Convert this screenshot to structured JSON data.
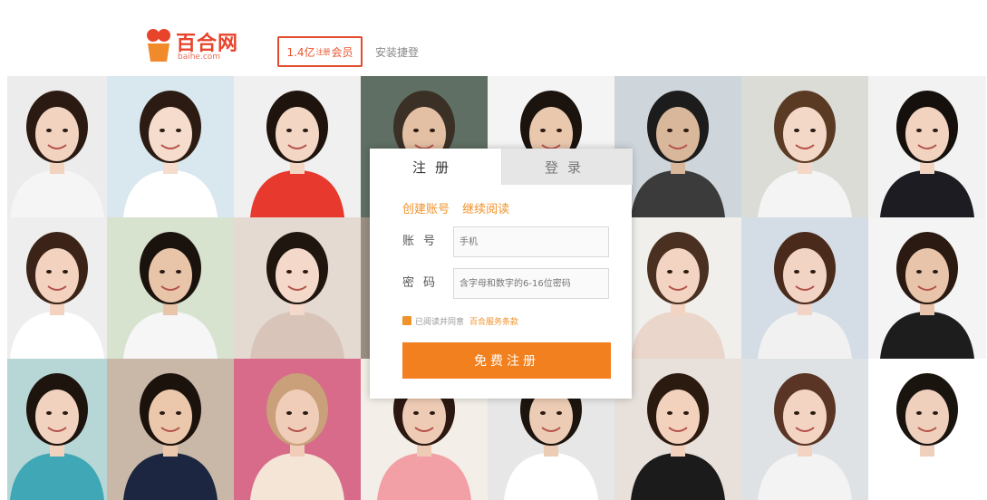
{
  "header": {
    "logo_name": "百合网",
    "logo_domain": "baihe.com",
    "members_count": "1.4亿",
    "members_unit": "注册",
    "members_label": "会员",
    "link_text": "安装捷登"
  },
  "form": {
    "tabs": [
      "注册",
      "登录"
    ],
    "slogan": [
      "创建账号",
      "继续阅读"
    ],
    "account_label": "账号",
    "account_placeholder": "手机",
    "password_label": "密码",
    "password_placeholder": "含字母和数字的6-16位密码",
    "agree_text": "已阅读并同意",
    "agree_link": "百合服务条款",
    "submit_label": "免费注册"
  },
  "colors": {
    "brand": "#e8442b",
    "accent": "#f2801e"
  },
  "profiles": [
    {
      "skin": "#f2d3c0",
      "hair": "#2b1a12",
      "bg": "#ececec",
      "top": "#f5f5f5"
    },
    {
      "skin": "#f5dccc",
      "hair": "#2c1b12",
      "bg": "#d9e7ef",
      "top": "#ffffff"
    },
    {
      "skin": "#f3d6c4",
      "hair": "#1e130d",
      "bg": "#f0f0f0",
      "top": "#e8392f"
    },
    {
      "skin": "#e3c0a4",
      "hair": "#3b3026",
      "bg": "#5f6f63",
      "top": "#8d8d8d"
    },
    {
      "skin": "#eac8ae",
      "hair": "#1b130e",
      "bg": "#f4f4f4",
      "top": "#ffffff"
    },
    {
      "skin": "#d9b79a",
      "hair": "#1c1c1c",
      "bg": "#cfd6db",
      "top": "#3b3b3b"
    },
    {
      "skin": "#f4d8c7",
      "hair": "#5a3a23",
      "bg": "#dcdcd6",
      "top": "#f4f4f4"
    },
    {
      "skin": "#f1d3bf",
      "hair": "#15100c",
      "bg": "#f2f2f2",
      "top": "#1c1c22"
    },
    {
      "skin": "#f3d2bf",
      "hair": "#3b2417",
      "bg": "#eeeeee",
      "top": "#ffffff"
    },
    {
      "skin": "#e8c5a9",
      "hair": "#1a120c",
      "bg": "#d7e2cf",
      "top": "#f6f6f6"
    },
    {
      "skin": "#f4d9ca",
      "hair": "#1f1610",
      "bg": "#e5dad2",
      "top": "#d8c4b8"
    },
    {
      "skin": "#e0b89a",
      "hair": "#2a1b12",
      "bg": "#9b8f84",
      "top": "#d17c52"
    },
    {
      "skin": "#ecd0bc",
      "hair": "#2a2220",
      "bg": "#f1f1f1",
      "top": "#dddddd"
    },
    {
      "skin": "#f3d4c2",
      "hair": "#4a3020",
      "bg": "#f0efec",
      "top": "#ead6cb"
    },
    {
      "skin": "#f1d4c4",
      "hair": "#4a2a1a",
      "bg": "#d4dde6",
      "top": "#f1f1f1"
    },
    {
      "skin": "#e8c5aa",
      "hair": "#2b1a12",
      "bg": "#f4f4f4",
      "top": "#1d1d1d"
    },
    {
      "skin": "#f1d2be",
      "hair": "#1d140e",
      "bg": "#b7d7d6",
      "top": "#3fa7b5"
    },
    {
      "skin": "#ebc8ac",
      "hair": "#1b120c",
      "bg": "#c9b8a8",
      "top": "#1c2640"
    },
    {
      "skin": "#efcdb9",
      "hair": "#c9a07a",
      "bg": "#d86a8a",
      "top": "#f4e5d6"
    },
    {
      "skin": "#eecbb5",
      "hair": "#2b1810",
      "bg": "#f3efe8",
      "top": "#f29fa5"
    },
    {
      "skin": "#ecccb4",
      "hair": "#1c140e",
      "bg": "#e7e7e7",
      "top": "#ffffff"
    },
    {
      "skin": "#f2d1bd",
      "hair": "#2b1a10",
      "bg": "#e8e0da",
      "top": "#1b1b1b"
    },
    {
      "skin": "#f3d4c3",
      "hair": "#5a3525",
      "bg": "#dfe2e4",
      "top": "#f3f3f3"
    },
    {
      "skin": "#eed0bd",
      "hair": "#1a140f",
      "bg": "#ffffff",
      "top": "#ffffff"
    }
  ]
}
